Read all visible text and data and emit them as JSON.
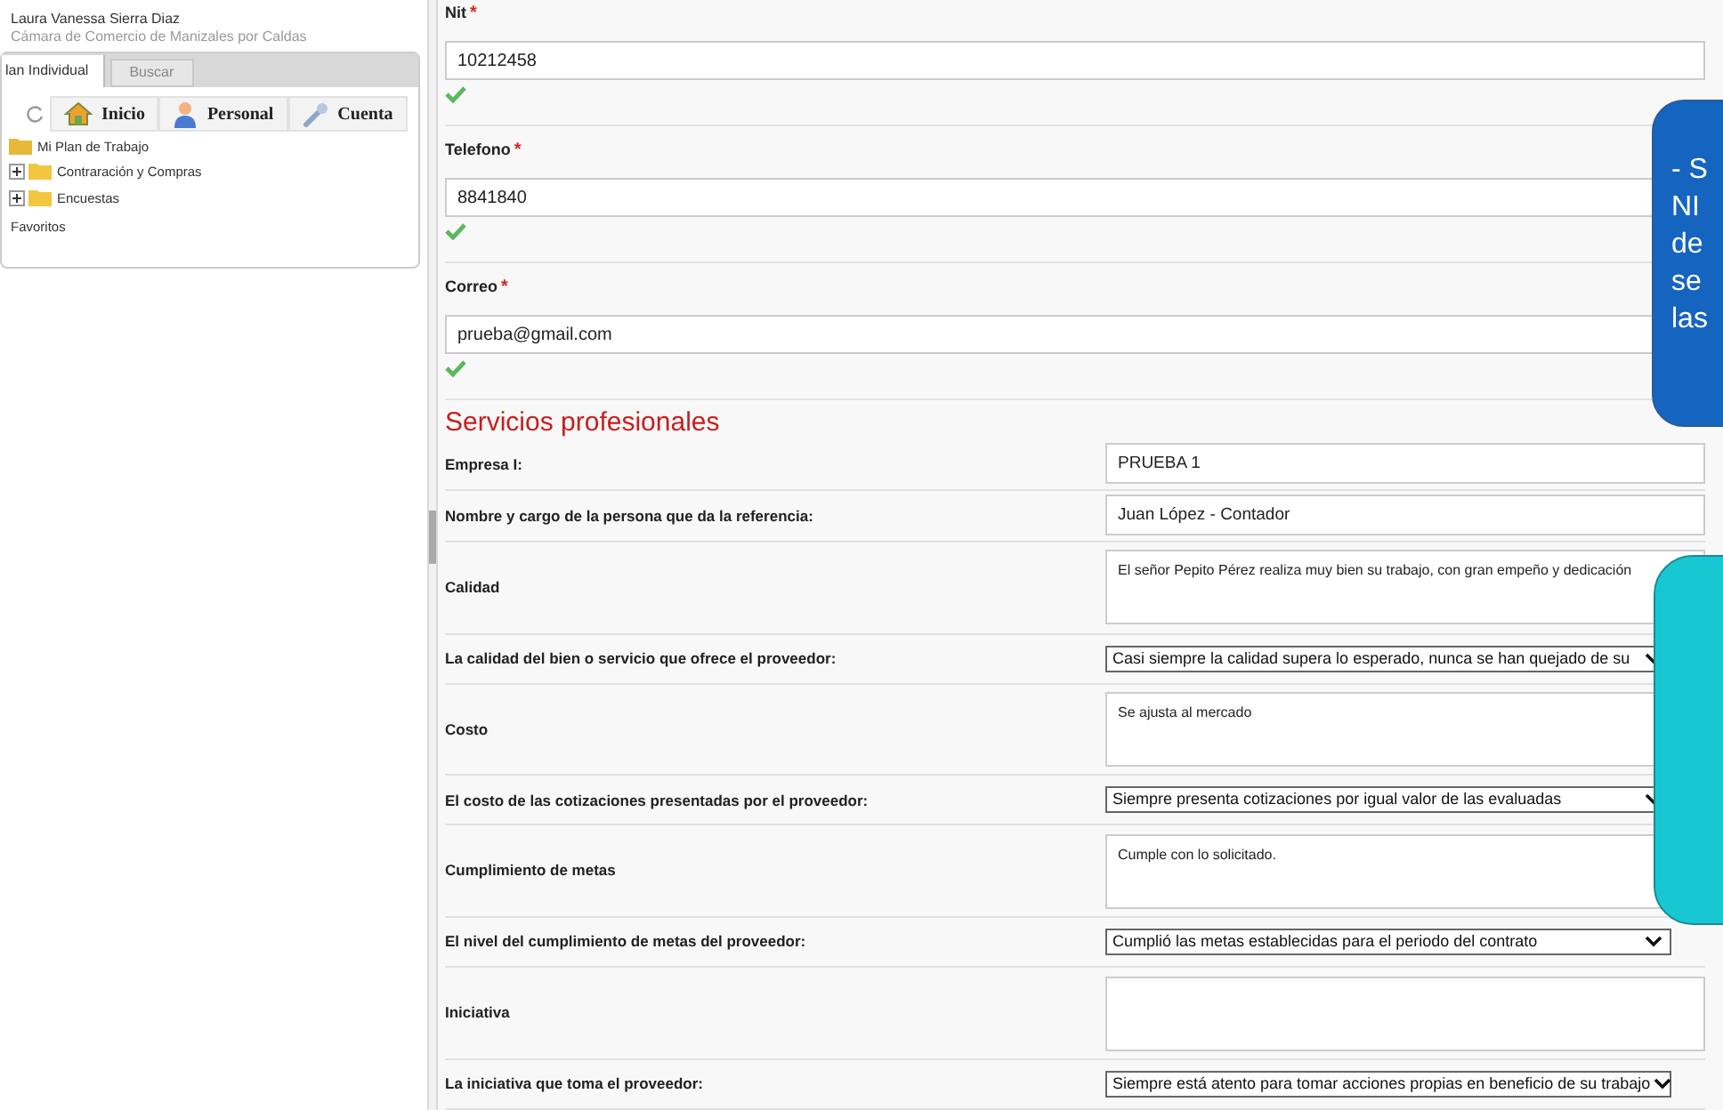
{
  "user": {
    "name": "Laura Vanessa Sierra Diaz",
    "organization": "Cámara de Comercio de Manizales por Caldas"
  },
  "tabs": [
    {
      "label": "lan Individual",
      "selected": true
    },
    {
      "label": "Buscar",
      "selected": false
    }
  ],
  "toolbar": [
    {
      "label": "Inicio",
      "kind": "home"
    },
    {
      "label": "Personal",
      "kind": "person"
    },
    {
      "label": "Cuenta",
      "kind": "wrench"
    }
  ],
  "tree": [
    {
      "label": "Mi Plan de Trabajo",
      "kind": "folder-open"
    },
    {
      "label": "Contraración y Compras",
      "kind": "folder-collapsed"
    },
    {
      "label": "Encuestas",
      "kind": "folder-collapsed"
    },
    {
      "label": "Favoritos",
      "kind": "text"
    }
  ],
  "contact_fields": [
    {
      "label": "Nit",
      "required_mark": "*",
      "value": "10212458",
      "valid": true
    },
    {
      "label": "Telefono",
      "required_mark": "*",
      "value": "8841840",
      "valid": true
    },
    {
      "label": "Correo",
      "required_mark": "*",
      "value": "prueba@gmail.com",
      "valid": true
    }
  ],
  "section_title": "Servicios profesionales",
  "evaluation_rows": [
    {
      "label": "Empresa I:",
      "kind": "input",
      "value": "PRUEBA 1"
    },
    {
      "label": "Nombre y cargo de la persona que da la referencia:",
      "kind": "input",
      "value": "Juan López - Contador"
    },
    {
      "label": "Calidad",
      "kind": "textarea",
      "value": "El señor Pepito Pérez realiza muy bien su trabajo, con gran empeño y dedicación"
    },
    {
      "label": "La calidad del bien o servicio que ofrece el proveedor:",
      "kind": "select",
      "value": "Casi siempre la calidad supera lo esperado, nunca se han quejado de su"
    },
    {
      "label": "Costo",
      "kind": "textarea",
      "value": "Se ajusta al mercado"
    },
    {
      "label": "El costo de las cotizaciones presentadas por el proveedor:",
      "kind": "select",
      "value": "Siempre presenta cotizaciones por igual valor de las evaluadas"
    },
    {
      "label": "Cumplimiento de metas",
      "kind": "textarea",
      "value": "Cumple con lo solicitado."
    },
    {
      "label": "El nivel del cumplimiento de metas del proveedor:",
      "kind": "select",
      "value": "Cumplió las metas establecidas para el periodo del contrato"
    },
    {
      "label": "Iniciativa",
      "kind": "textarea"
    },
    {
      "label": "La iniciativa que toma el proveedor:",
      "kind": "select",
      "value": "Siempre está atento para tomar acciones propias en beneficio de su trabajo"
    }
  ],
  "callouts": [
    {
      "color": "#1565c0",
      "lines": [
        "- S",
        "NI",
        "de",
        "se",
        "las"
      ]
    },
    {
      "color": "#17c7d2"
    }
  ]
}
